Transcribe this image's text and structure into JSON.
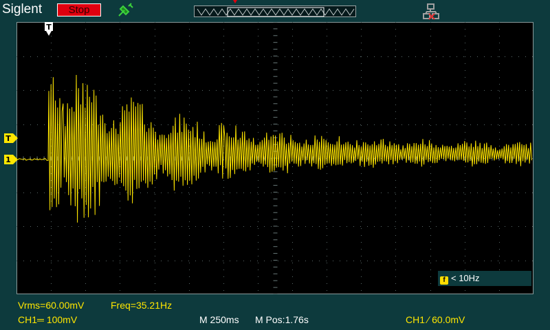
{
  "header": {
    "brand": "Siglent",
    "run_state": "Stop",
    "usb_icon": "usb-icon",
    "network_icon": "network-icon"
  },
  "markers": {
    "trigger_position": "T",
    "trigger_level": "T",
    "channel1": "1"
  },
  "filter": {
    "badge": "f",
    "label": "< 10Hz"
  },
  "measurements": {
    "vrms": "Vrms=60.00mV",
    "freq": "Freq=35.21Hz"
  },
  "status": {
    "ch1_scale": "CH1═ 100mV",
    "timebase": "M 250ms",
    "mpos": "M Pos:1.76s",
    "trigger": "CH1 ∕ 60.0mV"
  },
  "colors": {
    "trace": "#ffe600",
    "background": "#0d3a3d",
    "stop": "#e0000f"
  }
}
